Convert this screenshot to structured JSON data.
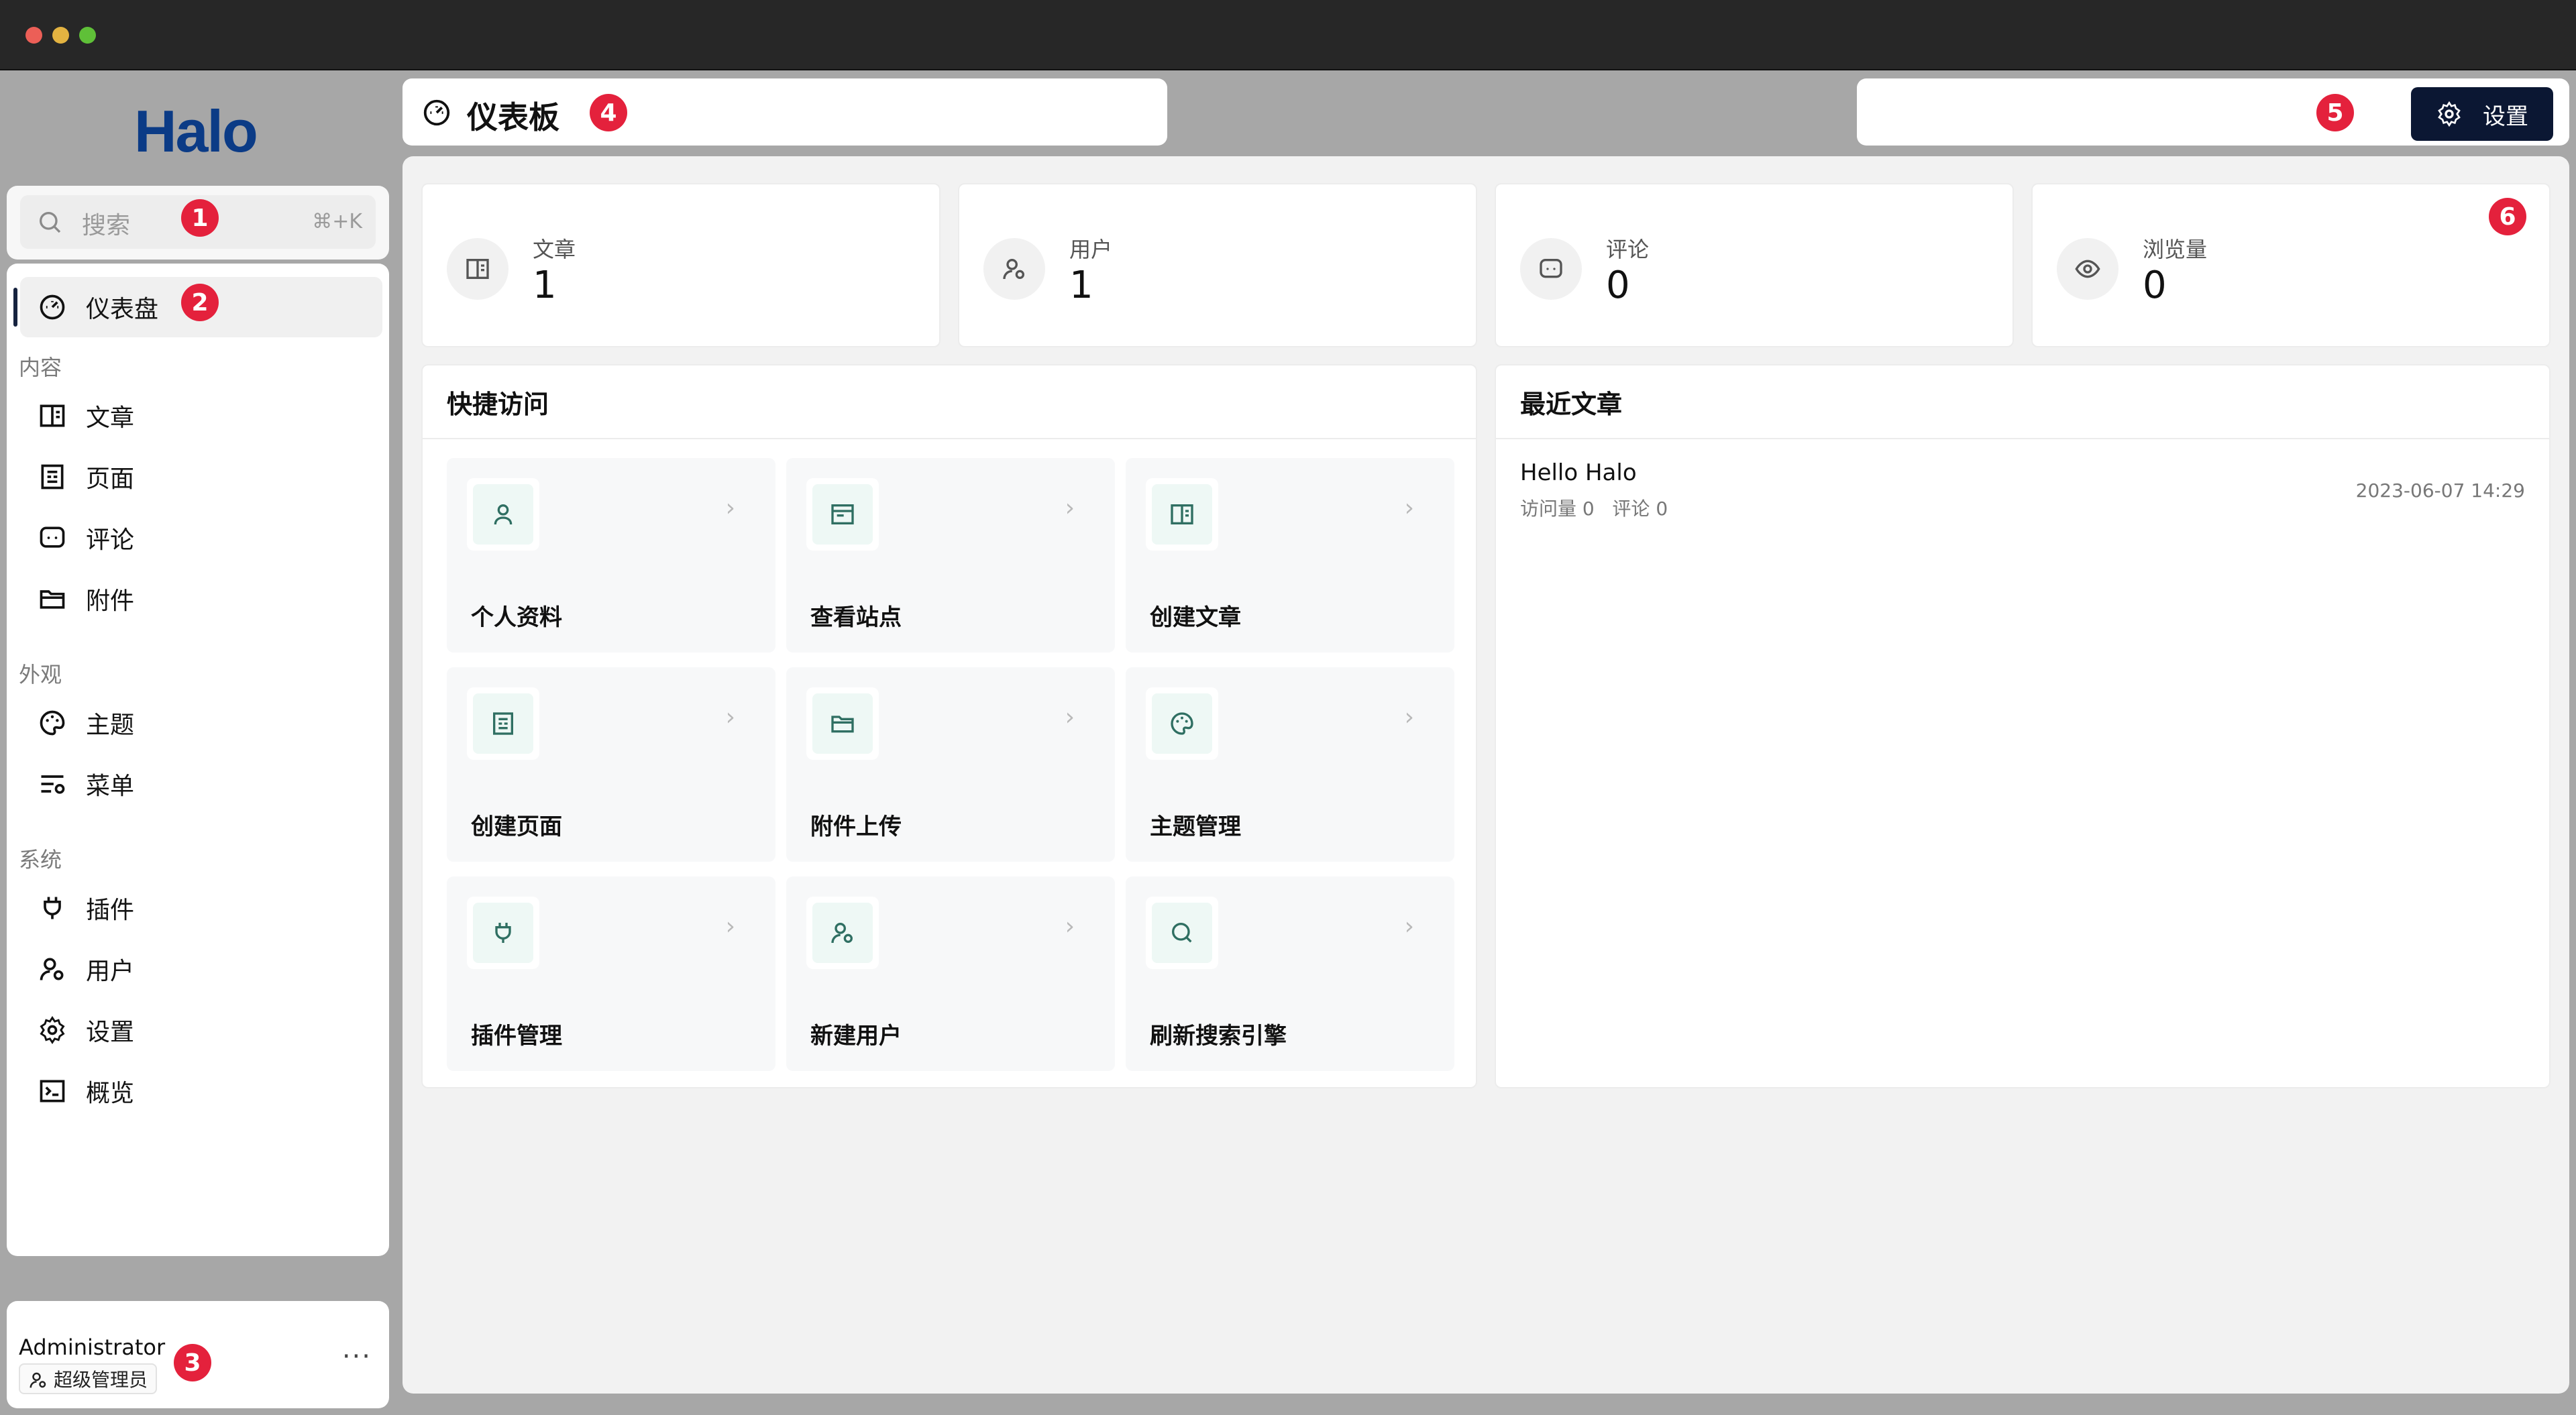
{
  "colors": {
    "brand": "#0b3b86",
    "primary_button": "#0b1733",
    "badge": "#e4213c",
    "accent_teal": "#2f6f62"
  },
  "logo": "Halo",
  "search": {
    "placeholder": "搜索",
    "shortcut": "⌘+K"
  },
  "nav": {
    "dashboard": "仪表盘",
    "groups": {
      "content": "内容",
      "appearance": "外观",
      "system": "系统"
    },
    "items": {
      "posts": "文章",
      "pages": "页面",
      "comments": "评论",
      "attachments": "附件",
      "themes": "主题",
      "menus": "菜单",
      "plugins": "插件",
      "users": "用户",
      "settings": "设置",
      "overview": "概览"
    }
  },
  "user": {
    "name": "Administrator",
    "role": "超级管理员",
    "more": "···"
  },
  "header": {
    "title": "仪表板",
    "settings_label": "设置"
  },
  "stats": [
    {
      "label": "文章",
      "value": "1",
      "icon": "book-icon"
    },
    {
      "label": "用户",
      "value": "1",
      "icon": "user-gear-icon"
    },
    {
      "label": "评论",
      "value": "0",
      "icon": "comment-icon"
    },
    {
      "label": "浏览量",
      "value": "0",
      "icon": "eye-icon"
    }
  ],
  "quick_access": {
    "title": "快捷访问",
    "items": [
      {
        "label": "个人资料",
        "icon": "user-icon"
      },
      {
        "label": "查看站点",
        "icon": "browser-icon"
      },
      {
        "label": "创建文章",
        "icon": "book-icon"
      },
      {
        "label": "创建页面",
        "icon": "page-icon"
      },
      {
        "label": "附件上传",
        "icon": "folder-icon"
      },
      {
        "label": "主题管理",
        "icon": "palette-icon"
      },
      {
        "label": "插件管理",
        "icon": "plug-icon"
      },
      {
        "label": "新建用户",
        "icon": "user-gear-icon"
      },
      {
        "label": "刷新搜索引擎",
        "icon": "search-icon"
      }
    ]
  },
  "recent_posts": {
    "title": "最近文章",
    "items": [
      {
        "title": "Hello Halo",
        "visits": "访问量 0",
        "comments": "评论 0",
        "date": "2023-06-07 14:29"
      }
    ]
  },
  "badges": [
    "1",
    "2",
    "3",
    "4",
    "5",
    "6"
  ]
}
